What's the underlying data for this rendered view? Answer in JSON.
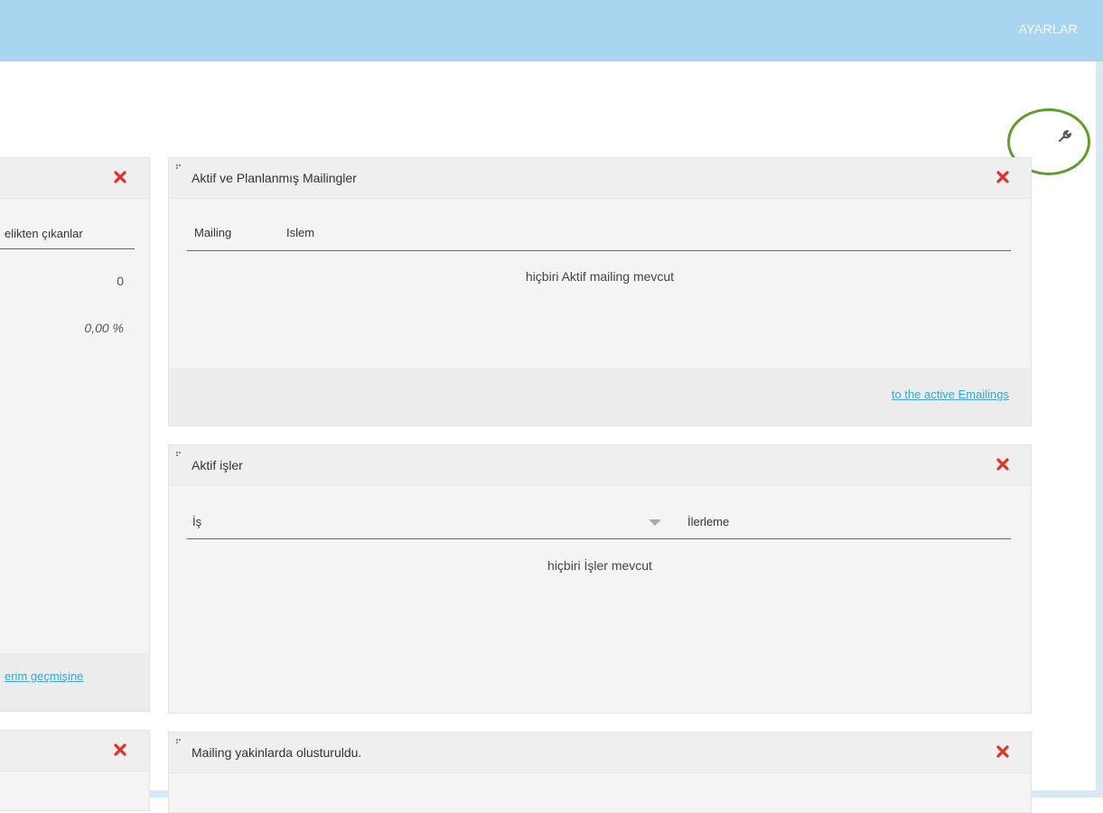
{
  "header": {
    "settings_label": "AYARLAR"
  },
  "toolbar": {
    "wrench_icon": "wrench-icon"
  },
  "left_panel": {
    "column_header": "elikten çıkanlar",
    "value": "0",
    "percent": "0,00 %",
    "footer_link": "erim geçmişine"
  },
  "active_mailings": {
    "title": "Aktif ve Planlanmış Mailingler",
    "columns": [
      "Mailing",
      "Islem"
    ],
    "empty_message": "hiçbiri Aktif mailing mevcut",
    "footer_link": "to the active Emailings"
  },
  "active_jobs": {
    "title": "Aktif işler",
    "columns": [
      "İş",
      "İlerleme"
    ],
    "empty_message": "hiçbiri İşler mevcut"
  },
  "recent_mailings": {
    "title": "Mailing yakinlarda olusturuldu."
  },
  "colors": {
    "topbar": "#a8d6f0",
    "close_icon": "#e0312a",
    "link": "#3aa7d6",
    "highlight_circle": "#5e9e2e"
  }
}
